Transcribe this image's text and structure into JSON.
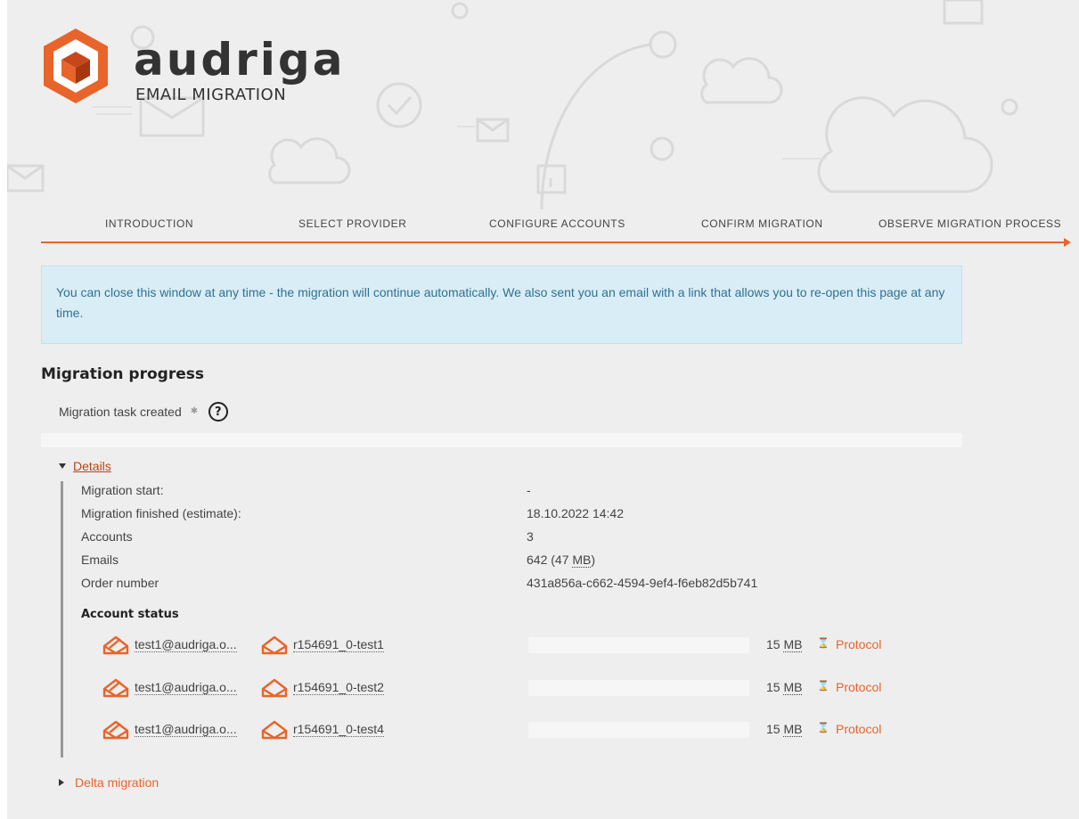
{
  "brand": {
    "name": "audriga",
    "subtitle": "EMAIL MIGRATION",
    "accent_color": "#e8642a"
  },
  "steps": [
    {
      "label": "INTRODUCTION"
    },
    {
      "label": "SELECT PROVIDER"
    },
    {
      "label": "CONFIGURE ACCOUNTS"
    },
    {
      "label": "CONFIRM MIGRATION"
    },
    {
      "label": "OBSERVE MIGRATION PROCESS"
    }
  ],
  "info": {
    "text": "You can close this window at any time - the migration will continue automatically. We also sent you an email with a link that allows you to re-open this page at any time."
  },
  "progress": {
    "title": "Migration progress",
    "status": "Migration task created",
    "percent": 0
  },
  "details": {
    "toggle_label": "Details",
    "rows": [
      {
        "key": "Migration start:",
        "value": "-"
      },
      {
        "key": "Migration finished (estimate):",
        "value": "18.10.2022 14:42"
      },
      {
        "key": "Accounts",
        "value": "3"
      },
      {
        "key": "Emails",
        "value": "642 (47 ",
        "unit": "MB",
        "suffix": ")"
      },
      {
        "key": "Order number",
        "value": "431a856a-c662-4594-9ef4-f6eb82d5b741"
      }
    ],
    "account_status_title": "Account status",
    "accounts": [
      {
        "source": "test1@audriga.o...",
        "target": "r154691_0-test1",
        "size": "15 ",
        "unit": "MB",
        "progress": 0,
        "protocol": "Protocol"
      },
      {
        "source": "test1@audriga.o...",
        "target": "r154691_0-test2",
        "size": "15 ",
        "unit": "MB",
        "progress": 0,
        "protocol": "Protocol"
      },
      {
        "source": "test1@audriga.o...",
        "target": "r154691_0-test4",
        "size": "15 ",
        "unit": "MB",
        "progress": 0,
        "protocol": "Protocol"
      }
    ]
  },
  "delta": {
    "label": "Delta migration"
  }
}
